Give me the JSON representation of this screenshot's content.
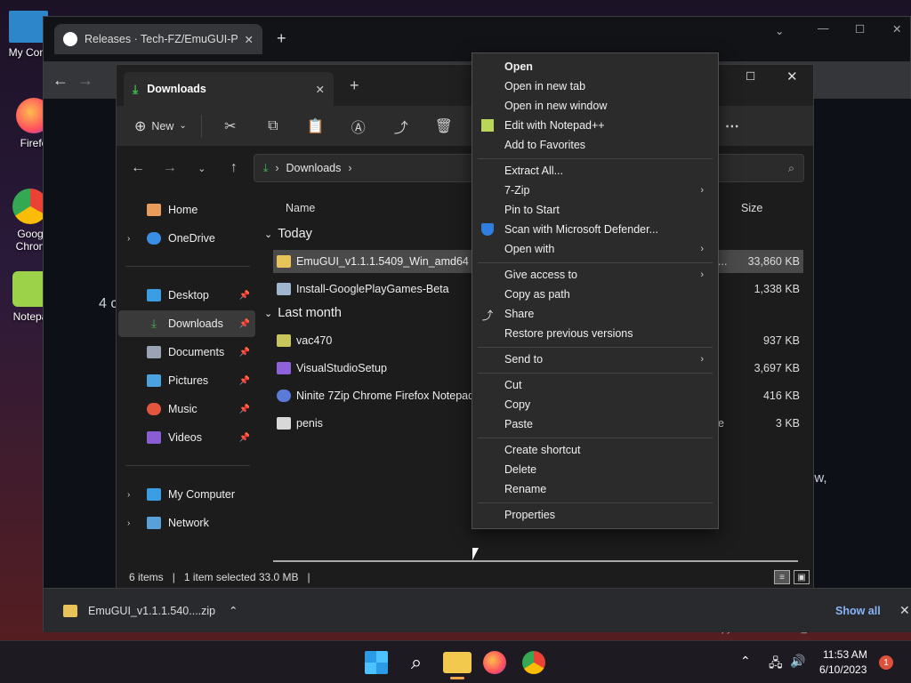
{
  "desktop": {
    "icons": [
      "My Com",
      "Firefo",
      "Goog Chron",
      "Notepa"
    ]
  },
  "chrome": {
    "tab_title": "Releases · Tech-FZ/EmuGUI-PreR",
    "page_text_1": "4 c",
    "page_text_2": "ow,",
    "page_text_3": "Evaluation copy. Build 23393.zn_release.230320-1652",
    "download_file": "EmuGUI_v1.1.1.540....zip",
    "show_all": "Show all"
  },
  "explorer": {
    "tab_title": "Downloads",
    "new_label": "New",
    "breadcrumb": "Downloads",
    "sidebar": [
      {
        "label": "Home",
        "icon": "home-icon"
      },
      {
        "label": "OneDrive",
        "icon": "cloud-icon"
      },
      {
        "label": "Desktop",
        "icon": "desktop-icon"
      },
      {
        "label": "Downloads",
        "icon": "download-icon"
      },
      {
        "label": "Documents",
        "icon": "document-icon"
      },
      {
        "label": "Pictures",
        "icon": "picture-icon"
      },
      {
        "label": "Music",
        "icon": "music-icon"
      },
      {
        "label": "Videos",
        "icon": "video-icon"
      },
      {
        "label": "My Computer",
        "icon": "computer-icon"
      },
      {
        "label": "Network",
        "icon": "network-icon"
      }
    ],
    "columns": {
      "name": "Name",
      "size": "Size"
    },
    "groups": {
      "today": "Today",
      "last_month": "Last month"
    },
    "files_today": [
      {
        "name": "EmuGUI_v1.1.1.5409_Win_amd64",
        "size": "33,860 KB",
        "extra": "..."
      },
      {
        "name": "Install-GooglePlayGames-Beta",
        "size": "1,338 KB"
      }
    ],
    "files_last_month": [
      {
        "name": "vac470",
        "size": "937 KB"
      },
      {
        "name": "VisualStudioSetup",
        "size": "3,697 KB"
      },
      {
        "name": "Ninite 7Zip Chrome Firefox Notepad In",
        "size": "416 KB"
      },
      {
        "name": "penis",
        "size": "3 KB",
        "extra": "e"
      }
    ],
    "status": {
      "items": "6 items",
      "selected": "1 item selected  33.0 MB"
    }
  },
  "context_menu": {
    "groups": [
      [
        {
          "label": "Open",
          "bold": true
        },
        {
          "label": "Open in new tab"
        },
        {
          "label": "Open in new window"
        },
        {
          "label": "Edit with Notepad++",
          "icon": "notepadpp-icon"
        },
        {
          "label": "Add to Favorites"
        }
      ],
      [
        {
          "label": "Extract All..."
        },
        {
          "label": "7-Zip",
          "submenu": true
        },
        {
          "label": "Pin to Start"
        },
        {
          "label": "Scan with Microsoft Defender...",
          "icon": "defender-shield-icon"
        },
        {
          "label": "Open with",
          "submenu": true
        }
      ],
      [
        {
          "label": "Give access to",
          "submenu": true
        },
        {
          "label": "Copy as path"
        },
        {
          "label": "Share",
          "icon": "share-icon"
        },
        {
          "label": "Restore previous versions"
        }
      ],
      [
        {
          "label": "Send to",
          "submenu": true
        }
      ],
      [
        {
          "label": "Cut"
        },
        {
          "label": "Copy"
        },
        {
          "label": "Paste"
        }
      ],
      [
        {
          "label": "Create shortcut"
        },
        {
          "label": "Delete"
        },
        {
          "label": "Rename"
        }
      ],
      [
        {
          "label": "Properties"
        }
      ]
    ]
  },
  "taskbar": {
    "time": "11:53 AM",
    "date": "6/10/2023",
    "notification_count": "1"
  }
}
